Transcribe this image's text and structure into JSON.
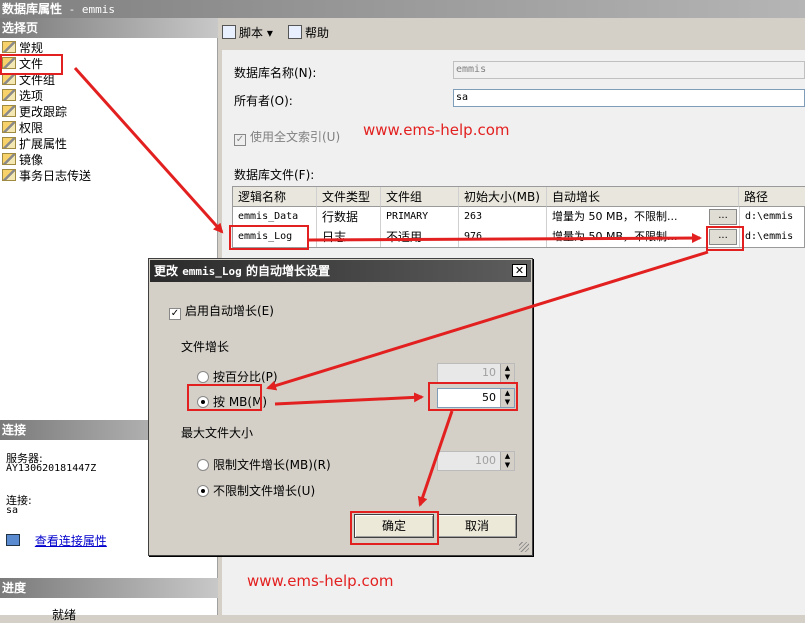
{
  "window": {
    "title": "数据库属性",
    "db_suffix": " - emmis"
  },
  "left": {
    "select_page_header": "选择页",
    "pages": [
      "常规",
      "文件",
      "文件组",
      "选项",
      "更改跟踪",
      "权限",
      "扩展属性",
      "镜像",
      "事务日志传送"
    ],
    "connection_header": "连接",
    "server_label": "服务器:",
    "server_value": "AY130620181447Z",
    "connection_label": "连接:",
    "connection_value": "sa",
    "view_conn_props": "查看连接属性",
    "progress_header": "进度",
    "progress_status": "就绪"
  },
  "toolbar": {
    "script_label": "脚本",
    "help_label": "帮助"
  },
  "form": {
    "db_name_label": "数据库名称(N):",
    "db_name_value": "emmis",
    "owner_label": "所有者(O):",
    "owner_value": "sa",
    "fulltext_label": "使用全文索引(U)",
    "db_files_label": "数据库文件(F):"
  },
  "grid": {
    "columns": [
      "逻辑名称",
      "文件类型",
      "文件组",
      "初始大小(MB)",
      "自动增长",
      "路径"
    ],
    "rows": [
      [
        "emmis_Data",
        "行数据",
        "PRIMARY",
        "263",
        "增量为 50 MB，不限制...",
        "d:\\emmis"
      ],
      [
        "emmis_Log",
        "日志",
        "不适用",
        "976",
        "增量为 50 MB，不限制...",
        "d:\\emmis"
      ]
    ],
    "dots_label": "..."
  },
  "watermark": "www.ems-help.com",
  "dialog": {
    "title_pre": "更改 ",
    "title_name": "emmis_Log",
    "title_post": " 的自动增长设置",
    "close_label": "✕",
    "enable_autogrow": "启用自动增长(E)",
    "file_growth": "文件增长",
    "by_percent": "按百分比(P)",
    "percent_value": "10",
    "by_mb": "按 MB(M)",
    "mb_value": "50",
    "max_size": "最大文件大小",
    "limit_growth": "限制文件增长(MB)(R)",
    "limit_value": "100",
    "unlimited": "不限制文件增长(U)",
    "ok_label": "确定",
    "cancel_label": "取消"
  },
  "colors": {
    "annotation": "#e32020"
  }
}
